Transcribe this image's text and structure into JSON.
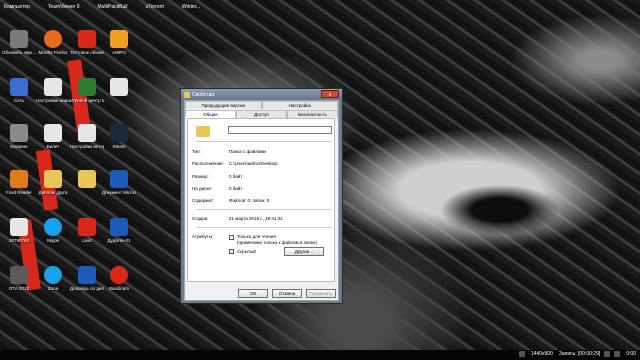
{
  "topbar": {
    "labels": [
      "Компьютер",
      "TeamViewer 9",
      "MultiPackBull",
      "uTorrent",
      "Winter..."
    ]
  },
  "desktop_icons": [
    {
      "label": "Обновить звук...",
      "icon": "settings-icon",
      "color": "#7a7a7a"
    },
    {
      "label": "Mozilla Firefox",
      "icon": "firefox-icon",
      "color": "#e86c1b"
    },
    {
      "label": "Тестовое обновление",
      "icon": "document-icon",
      "color": "#d8281c"
    },
    {
      "label": "AIMP3",
      "icon": "aimp-icon",
      "color": "#f0a020"
    },
    {
      "label": "Сеть",
      "icon": "network-icon",
      "color": "#3a6fd0"
    },
    {
      "label": "Настройки маршрутизатора",
      "icon": "document-icon",
      "color": "#e6e6e6"
    },
    {
      "label": "Игровой центр Mail.Ru",
      "icon": "game-icon",
      "color": "#2e7d32"
    },
    {
      "label": "",
      "icon": "document-icon",
      "color": "#e6e6e6"
    },
    {
      "label": "Корзина",
      "icon": "trash-icon",
      "color": "#8a8a8a"
    },
    {
      "label": "Билет",
      "icon": "document-icon",
      "color": "#e6e6e6"
    },
    {
      "label": "Настройки интернета",
      "icon": "document-icon",
      "color": "#e6e6e6"
    },
    {
      "label": "Steam",
      "icon": "steam-icon",
      "color": "#1b2838"
    },
    {
      "label": "Foxit Reader",
      "icon": "pdf-icon",
      "color": "#e07a1a"
    },
    {
      "label": "Диплом друга",
      "icon": "folder-icon",
      "color": "#e8c65a"
    },
    {
      "label": "",
      "icon": "folder-icon",
      "color": "#e8c65a"
    },
    {
      "label": "Документ Microsoft...",
      "icon": "word-icon",
      "color": "#1e5bb8"
    },
    {
      "label": "30790763",
      "icon": "document-icon",
      "color": "#e6e6e6"
    },
    {
      "label": "Skype",
      "icon": "skype-icon",
      "color": "#1aa3e8"
    },
    {
      "label": "Livid",
      "icon": "app-icon",
      "color": "#d8281c"
    },
    {
      "label": "Дудатек-01",
      "icon": "word-icon",
      "color": "#1e5bb8"
    },
    {
      "label": "GTA 2012",
      "icon": "game-icon",
      "color": "#5a5a5a"
    },
    {
      "label": "Zona",
      "icon": "zona-icon",
      "color": "#1aa3e8"
    },
    {
      "label": "Доповідь по дипломной",
      "icon": "word-icon",
      "color": "#1e5bb8"
    },
    {
      "label": "Bandicam",
      "icon": "bandicam-icon",
      "color": "#d8281c"
    }
  ],
  "dialog": {
    "title": "Свойства:",
    "close_label": "x",
    "tabs_row1": [
      "Предыдущие версии",
      "Настройка"
    ],
    "tabs_row2": [
      "Общие",
      "Доступ",
      "Безопасность"
    ],
    "name_value": "",
    "props": [
      {
        "label": "Тип:",
        "value": "Папка с файлами"
      },
      {
        "label": "Расположение:",
        "value": "C:\\Users\\admin\\Desktop"
      },
      {
        "label": "Размер:",
        "value": "0 байт"
      },
      {
        "label": "На диске:",
        "value": "0 байт"
      },
      {
        "label": "Содержит:",
        "value": "Файлов: 0; папок: 0"
      },
      {
        "label": "Создан:",
        "value": "21 марта 2015 г., 18:41:42"
      }
    ],
    "attributes_label": "Атрибуты:",
    "readonly_label": "Только для чтения",
    "readonly_sub": "(применимо только к файлам в папке)",
    "hidden_label": "Скрытый",
    "other_btn": "Другие...",
    "ok_btn": "ОК",
    "cancel_btn": "Отмена",
    "apply_btn": "Применить"
  },
  "taskbar": {
    "resolution": "1440x900",
    "recording": "Запись: [00:00:29]",
    "time": "0:00"
  }
}
